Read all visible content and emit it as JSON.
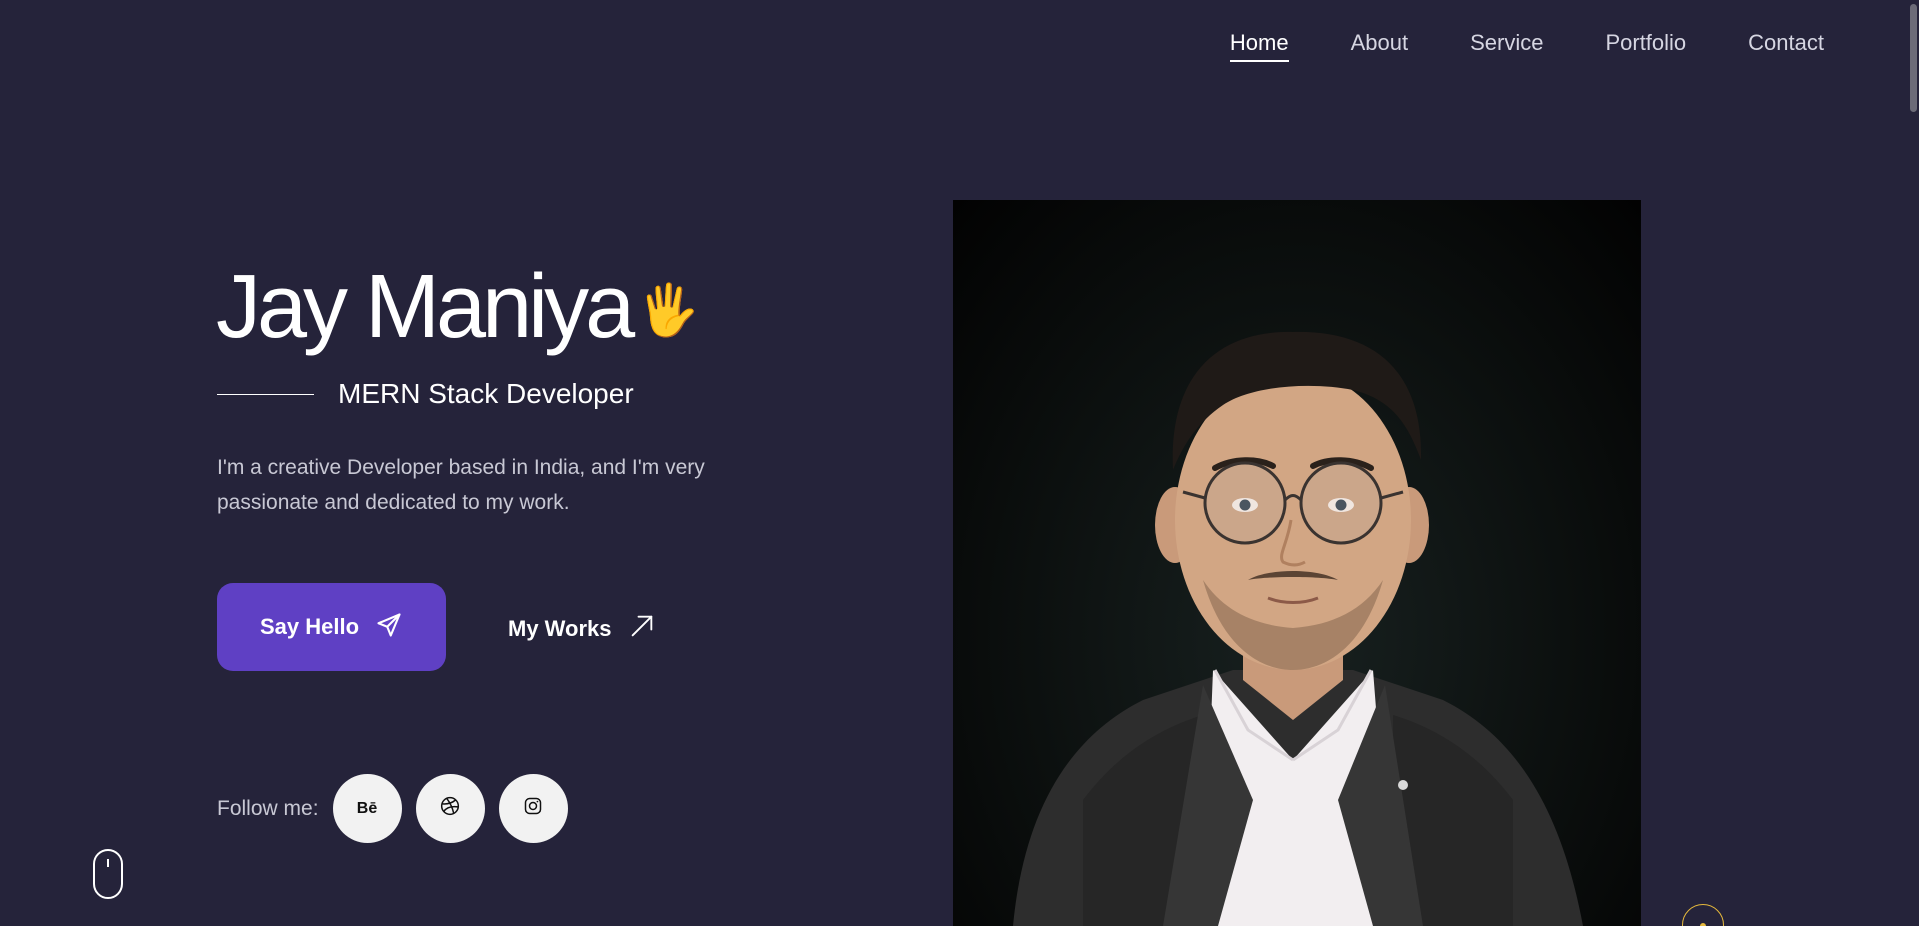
{
  "nav": {
    "items": [
      {
        "label": "Home"
      },
      {
        "label": "About"
      },
      {
        "label": "Service"
      },
      {
        "label": "Portfolio"
      },
      {
        "label": "Contact"
      }
    ],
    "active": "Home"
  },
  "hero": {
    "name": "Jay Maniya",
    "wave_emoji": "🖐",
    "subtitle": "MERN Stack Developer",
    "intro": "I'm a creative Developer based in India, and I'm very passionate and dedicated to my work.",
    "primary_button": {
      "label": "Say Hello",
      "icon": "paper-plane-icon"
    },
    "secondary_button": {
      "label": "My Works",
      "icon": "arrow-up-right-icon"
    },
    "follow_label": "Follow me:",
    "socials": [
      {
        "name": "behance",
        "glyph": "Bē"
      },
      {
        "name": "dribbble",
        "icon": "dribbble-icon"
      },
      {
        "name": "instagram",
        "icon": "instagram-icon"
      }
    ]
  },
  "colors": {
    "background": "#25233a",
    "accent": "#5f40c4",
    "highlight": "#e6b93c"
  }
}
